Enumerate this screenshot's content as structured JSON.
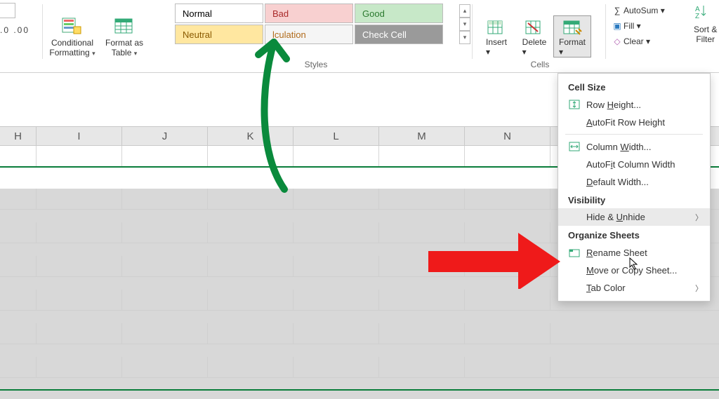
{
  "ribbon": {
    "number": {
      "placeholder": "",
      "dec_tip": ".0  .00"
    },
    "cond_fmt": {
      "label": "Conditional\nFormatting",
      "caret": "▾"
    },
    "fmt_table": {
      "label": "Format as\nTable",
      "caret": "▾"
    },
    "styles_label": "Styles",
    "styles": {
      "normal": "Normal",
      "bad": "Bad",
      "good": "Good",
      "neutral": "Neutral",
      "calc": "lculation",
      "check": "Check Cell"
    },
    "cells_label": "Cells",
    "insert": {
      "label": "Insert",
      "caret": "▾"
    },
    "delete": {
      "label": "Delete",
      "caret": "▾"
    },
    "format": {
      "label": "Format",
      "caret": "▾"
    },
    "editing": {
      "autosum": "AutoSum",
      "fill": "Fill",
      "clear": "Clear",
      "sort": "Sort &\nFilter"
    }
  },
  "columns": [
    "H",
    "I",
    "J",
    "K",
    "L",
    "M",
    "N"
  ],
  "menu": {
    "section_cell_size": "Cell Size",
    "row_height": "Row Height...",
    "autofit_row": "AutoFit Row Height",
    "col_width": "Column Width...",
    "autofit_col": "AutoFit Column Width",
    "default_width": "Default Width...",
    "section_visibility": "Visibility",
    "hide_unhide": "Hide & Unhide",
    "section_org": "Organize Sheets",
    "rename": "Rename Sheet",
    "move_copy": "Move or Copy Sheet...",
    "tab_color": "Tab Color"
  }
}
